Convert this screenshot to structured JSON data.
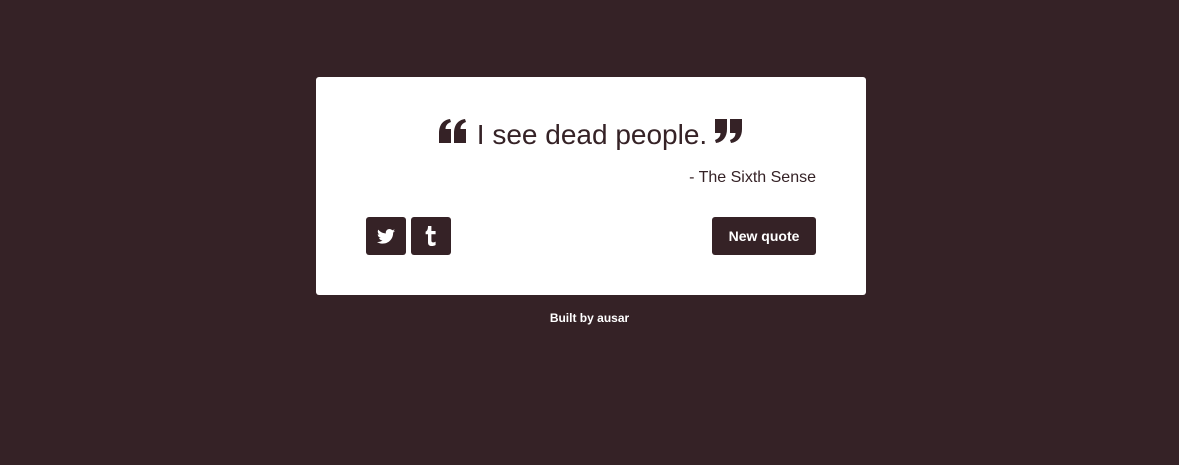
{
  "quote": {
    "text": "I see dead people.",
    "author": "- The Sixth Sense",
    "open_icon": "quote-left-icon",
    "close_icon": "quote-right-icon"
  },
  "share": {
    "twitter_icon": "twitter-icon",
    "tumblr_icon": "tumblr-icon"
  },
  "actions": {
    "new_quote_label": "New quote"
  },
  "footer": {
    "credit": "Built by ausar"
  },
  "colors": {
    "background": "#352226",
    "card": "#ffffff",
    "accent": "#352226",
    "button_text": "#ffffff"
  }
}
